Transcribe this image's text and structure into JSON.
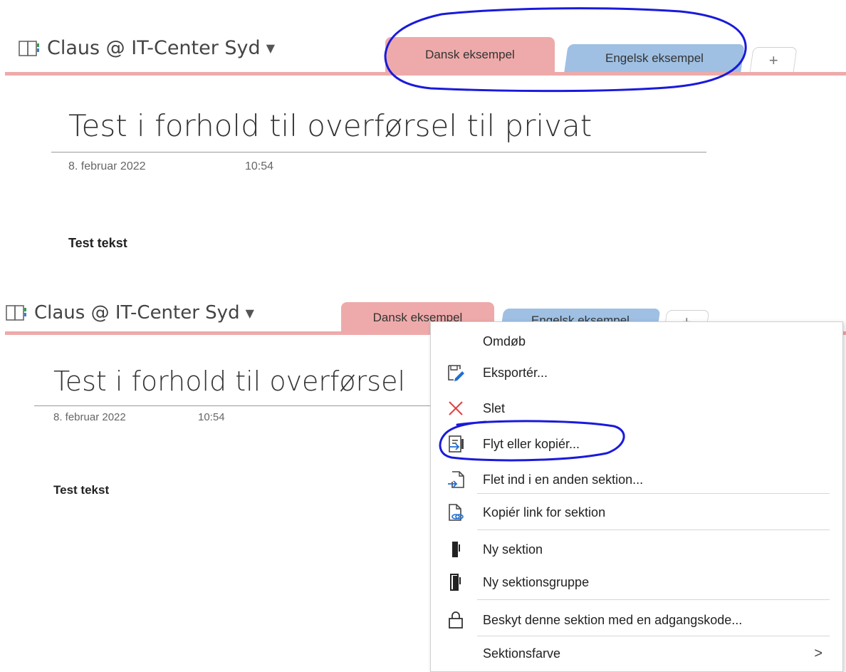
{
  "panel1": {
    "notebook_name": "Claus @ IT-Center Syd",
    "tabs": [
      {
        "label": "Dansk eksempel"
      },
      {
        "label": "Engelsk eksempel"
      }
    ],
    "add_tab_label": "+",
    "page_title": "Test i forhold til overførsel til privat",
    "date": "8. februar 2022",
    "time": "10:54",
    "body_text": "Test tekst"
  },
  "panel2": {
    "notebook_name": "Claus @ IT-Center Syd",
    "tabs": [
      {
        "label": "Dansk eksempel"
      },
      {
        "label": "Engelsk eksempel"
      }
    ],
    "add_tab_label": "+",
    "page_title": "Test i forhold til overførsel",
    "date": "8. februar 2022",
    "time": "10:54",
    "body_text": "Test tekst"
  },
  "context_menu": {
    "items": [
      {
        "label": "Omdøb",
        "icon": "none"
      },
      {
        "label": "Eksportér...",
        "icon": "export-icon"
      },
      {
        "label": "Slet",
        "icon": "delete-x-icon"
      },
      {
        "label": "Flyt eller kopiér...",
        "icon": "move-copy-icon"
      },
      {
        "label": "Flet ind i en anden sektion...",
        "icon": "merge-icon"
      },
      {
        "label": "Kopiér link for sektion",
        "icon": "link-icon"
      },
      {
        "label": "Ny sektion",
        "icon": "new-section-icon"
      },
      {
        "label": "Ny sektionsgruppe",
        "icon": "new-section-group-icon"
      },
      {
        "label": "Beskyt denne sektion med en adgangskode...",
        "icon": "lock-icon"
      },
      {
        "label": "Sektionsfarve",
        "icon": "none"
      }
    ],
    "submenu_arrow": ">"
  },
  "colors": {
    "tab_danish": "#eeaaaa",
    "tab_english": "#9fc0e3",
    "annotation": "#1a1adb",
    "delete_icon": "#e03c3c",
    "icon_blue": "#1f6fd1"
  }
}
